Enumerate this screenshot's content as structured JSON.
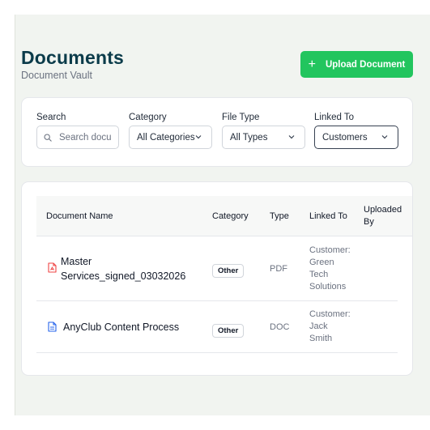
{
  "header": {
    "title": "Documents",
    "subtitle": "Document Vault",
    "upload_label": "Upload Document"
  },
  "filters": {
    "search": {
      "label": "Search",
      "placeholder": "Search docu"
    },
    "category": {
      "label": "Category",
      "value": "All Categories"
    },
    "file_type": {
      "label": "File Type",
      "value": "All Types"
    },
    "linked_to": {
      "label": "Linked To",
      "value": "Customers"
    }
  },
  "table": {
    "columns": [
      "Document Name",
      "Category",
      "Type",
      "Linked To",
      "Uploaded",
      "By"
    ],
    "rows": [
      {
        "name_line1": "Master",
        "name_line2": "Services_signed_03032026",
        "category": "Other",
        "type": "PDF",
        "linked_line1": "Customer:",
        "linked_line2": "Green",
        "linked_line3": "Tech",
        "linked_line4": "Solutions",
        "icon": "pdf-file-icon"
      },
      {
        "name_line1": "AnyClub Content Process",
        "category": "Other",
        "type": "DOC",
        "linked_line1": "Customer:",
        "linked_line2": "Jack",
        "linked_line3": "Smith",
        "icon": "doc-file-icon"
      }
    ]
  },
  "colors": {
    "accent": "#22c55e",
    "title": "#0b3b4a",
    "pdf_icon": "#ef4444",
    "doc_icon": "#2563eb"
  }
}
